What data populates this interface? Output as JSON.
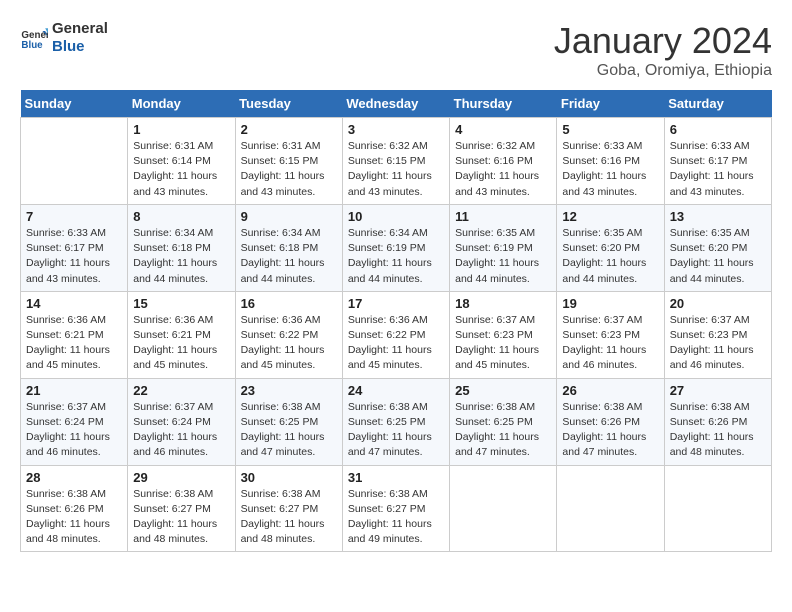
{
  "logo": {
    "text_general": "General",
    "text_blue": "Blue"
  },
  "title": "January 2024",
  "location": "Goba, Oromiya, Ethiopia",
  "header": {
    "days": [
      "Sunday",
      "Monday",
      "Tuesday",
      "Wednesday",
      "Thursday",
      "Friday",
      "Saturday"
    ]
  },
  "weeks": [
    [
      {
        "day": "",
        "sunrise": "",
        "sunset": "",
        "daylight": ""
      },
      {
        "day": "1",
        "sunrise": "6:31 AM",
        "sunset": "6:14 PM",
        "daylight": "11 hours and 43 minutes."
      },
      {
        "day": "2",
        "sunrise": "6:31 AM",
        "sunset": "6:15 PM",
        "daylight": "11 hours and 43 minutes."
      },
      {
        "day": "3",
        "sunrise": "6:32 AM",
        "sunset": "6:15 PM",
        "daylight": "11 hours and 43 minutes."
      },
      {
        "day": "4",
        "sunrise": "6:32 AM",
        "sunset": "6:16 PM",
        "daylight": "11 hours and 43 minutes."
      },
      {
        "day": "5",
        "sunrise": "6:33 AM",
        "sunset": "6:16 PM",
        "daylight": "11 hours and 43 minutes."
      },
      {
        "day": "6",
        "sunrise": "6:33 AM",
        "sunset": "6:17 PM",
        "daylight": "11 hours and 43 minutes."
      }
    ],
    [
      {
        "day": "7",
        "sunrise": "6:33 AM",
        "sunset": "6:17 PM",
        "daylight": "11 hours and 43 minutes."
      },
      {
        "day": "8",
        "sunrise": "6:34 AM",
        "sunset": "6:18 PM",
        "daylight": "11 hours and 44 minutes."
      },
      {
        "day": "9",
        "sunrise": "6:34 AM",
        "sunset": "6:18 PM",
        "daylight": "11 hours and 44 minutes."
      },
      {
        "day": "10",
        "sunrise": "6:34 AM",
        "sunset": "6:19 PM",
        "daylight": "11 hours and 44 minutes."
      },
      {
        "day": "11",
        "sunrise": "6:35 AM",
        "sunset": "6:19 PM",
        "daylight": "11 hours and 44 minutes."
      },
      {
        "day": "12",
        "sunrise": "6:35 AM",
        "sunset": "6:20 PM",
        "daylight": "11 hours and 44 minutes."
      },
      {
        "day": "13",
        "sunrise": "6:35 AM",
        "sunset": "6:20 PM",
        "daylight": "11 hours and 44 minutes."
      }
    ],
    [
      {
        "day": "14",
        "sunrise": "6:36 AM",
        "sunset": "6:21 PM",
        "daylight": "11 hours and 45 minutes."
      },
      {
        "day": "15",
        "sunrise": "6:36 AM",
        "sunset": "6:21 PM",
        "daylight": "11 hours and 45 minutes."
      },
      {
        "day": "16",
        "sunrise": "6:36 AM",
        "sunset": "6:22 PM",
        "daylight": "11 hours and 45 minutes."
      },
      {
        "day": "17",
        "sunrise": "6:36 AM",
        "sunset": "6:22 PM",
        "daylight": "11 hours and 45 minutes."
      },
      {
        "day": "18",
        "sunrise": "6:37 AM",
        "sunset": "6:23 PM",
        "daylight": "11 hours and 45 minutes."
      },
      {
        "day": "19",
        "sunrise": "6:37 AM",
        "sunset": "6:23 PM",
        "daylight": "11 hours and 46 minutes."
      },
      {
        "day": "20",
        "sunrise": "6:37 AM",
        "sunset": "6:23 PM",
        "daylight": "11 hours and 46 minutes."
      }
    ],
    [
      {
        "day": "21",
        "sunrise": "6:37 AM",
        "sunset": "6:24 PM",
        "daylight": "11 hours and 46 minutes."
      },
      {
        "day": "22",
        "sunrise": "6:37 AM",
        "sunset": "6:24 PM",
        "daylight": "11 hours and 46 minutes."
      },
      {
        "day": "23",
        "sunrise": "6:38 AM",
        "sunset": "6:25 PM",
        "daylight": "11 hours and 47 minutes."
      },
      {
        "day": "24",
        "sunrise": "6:38 AM",
        "sunset": "6:25 PM",
        "daylight": "11 hours and 47 minutes."
      },
      {
        "day": "25",
        "sunrise": "6:38 AM",
        "sunset": "6:25 PM",
        "daylight": "11 hours and 47 minutes."
      },
      {
        "day": "26",
        "sunrise": "6:38 AM",
        "sunset": "6:26 PM",
        "daylight": "11 hours and 47 minutes."
      },
      {
        "day": "27",
        "sunrise": "6:38 AM",
        "sunset": "6:26 PM",
        "daylight": "11 hours and 48 minutes."
      }
    ],
    [
      {
        "day": "28",
        "sunrise": "6:38 AM",
        "sunset": "6:26 PM",
        "daylight": "11 hours and 48 minutes."
      },
      {
        "day": "29",
        "sunrise": "6:38 AM",
        "sunset": "6:27 PM",
        "daylight": "11 hours and 48 minutes."
      },
      {
        "day": "30",
        "sunrise": "6:38 AM",
        "sunset": "6:27 PM",
        "daylight": "11 hours and 48 minutes."
      },
      {
        "day": "31",
        "sunrise": "6:38 AM",
        "sunset": "6:27 PM",
        "daylight": "11 hours and 49 minutes."
      },
      {
        "day": "",
        "sunrise": "",
        "sunset": "",
        "daylight": ""
      },
      {
        "day": "",
        "sunrise": "",
        "sunset": "",
        "daylight": ""
      },
      {
        "day": "",
        "sunrise": "",
        "sunset": "",
        "daylight": ""
      }
    ]
  ]
}
